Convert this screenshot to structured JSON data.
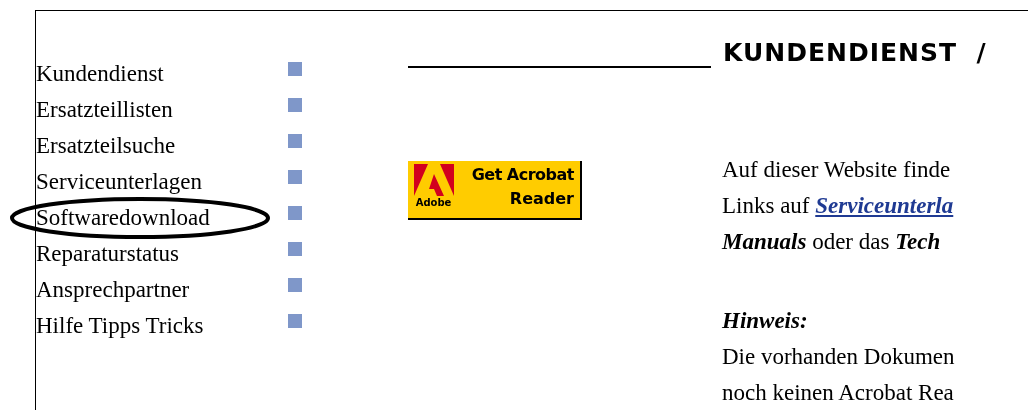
{
  "sidebar": {
    "items": [
      {
        "label": "Kundendienst",
        "circled": false
      },
      {
        "label": "Ersatzteillisten",
        "circled": false
      },
      {
        "label": "Ersatzteilsuche",
        "circled": false
      },
      {
        "label": "Serviceunterlagen",
        "circled": false
      },
      {
        "label": "Softwaredownload",
        "circled": true
      },
      {
        "label": "Reparaturstatus",
        "circled": false
      },
      {
        "label": "Ansprechpartner",
        "circled": false
      },
      {
        "label": "Hilfe Tipps Tricks",
        "circled": false
      }
    ]
  },
  "heading": "KUNDENDIENST  /",
  "acrobat_badge": {
    "brand": "Adobe",
    "line_1": "Get Acrobat",
    "line_2": "Reader"
  },
  "paragraphs": [
    {
      "lines": [
        [
          {
            "kind": "plain",
            "text": "Auf dieser Website finde"
          }
        ],
        [
          {
            "kind": "plain",
            "text": "Links auf "
          },
          {
            "kind": "link",
            "text": "Serviceunterla"
          }
        ],
        [
          {
            "kind": "emphasis",
            "text": "Manuals"
          },
          {
            "kind": "plain",
            "text": " oder das "
          },
          {
            "kind": "emphasis",
            "text": "Tech"
          }
        ]
      ]
    },
    {
      "lines": [
        [
          {
            "kind": "emphasis",
            "text": "Hinweis:"
          }
        ],
        [
          {
            "kind": "plain",
            "text": "Die vorhanden Dokumen"
          }
        ],
        [
          {
            "kind": "plain",
            "text": "noch keinen Acrobat Rea"
          }
        ]
      ]
    }
  ]
}
